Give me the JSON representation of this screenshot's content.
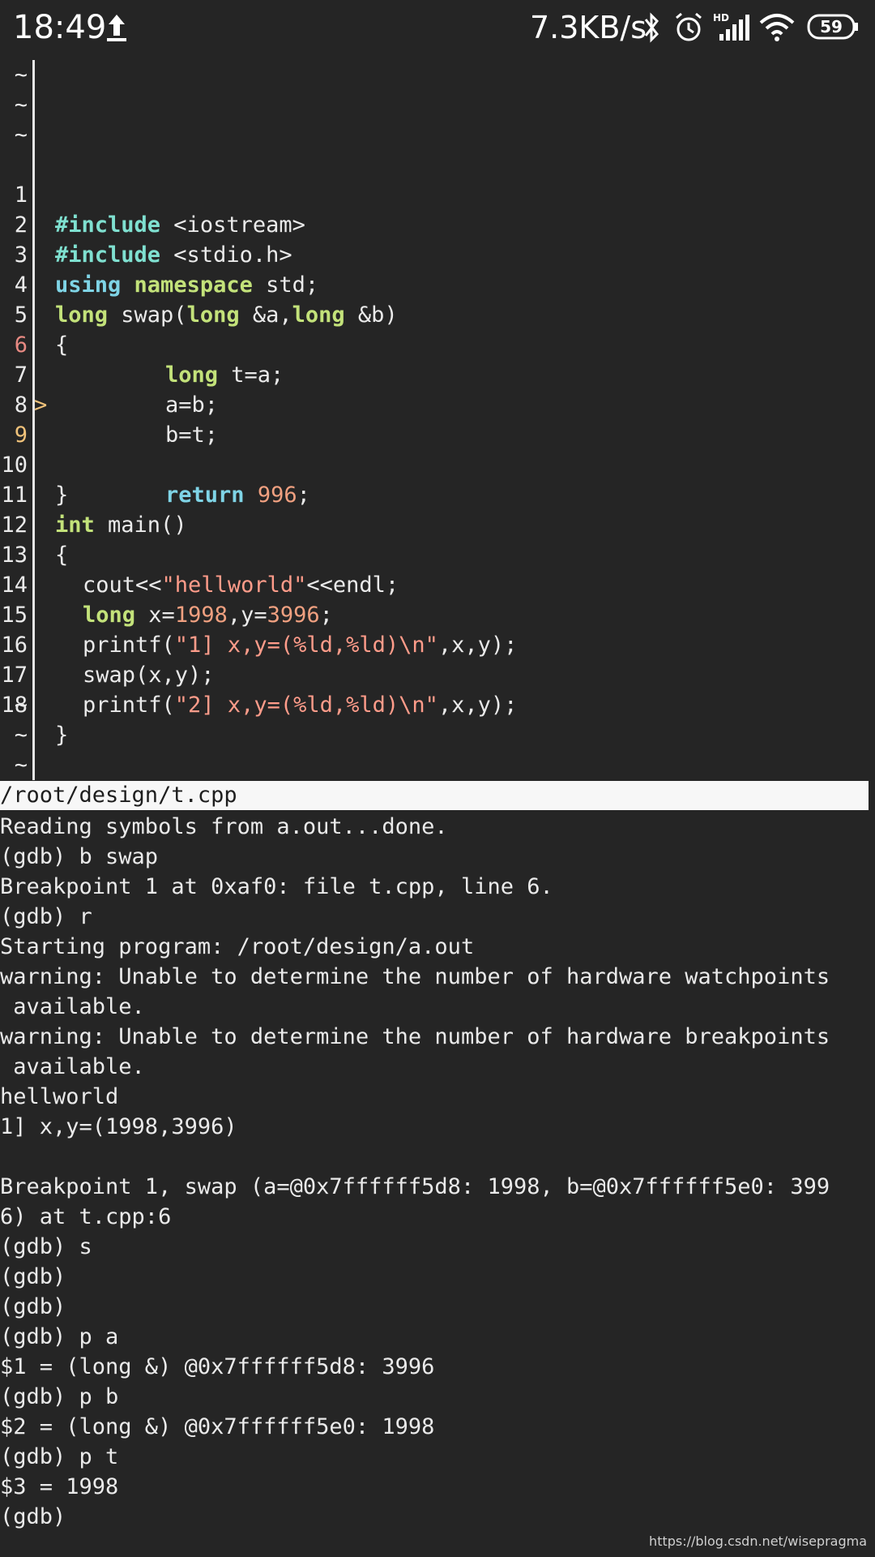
{
  "status_bar": {
    "time": "18:49",
    "net_speed": "7.3KB/s",
    "battery": "59",
    "icons": [
      "upload-icon",
      "bluetooth-icon",
      "alarm-icon",
      "hd-signal-icon",
      "wifi-icon",
      "battery-icon"
    ]
  },
  "editor": {
    "tilde": "~",
    "line_numbers": [
      "1",
      "2",
      "3",
      "4",
      "5",
      "6",
      "7",
      "8",
      "9",
      "10",
      "11",
      "12",
      "13",
      "14",
      "15",
      "16",
      "17",
      "18"
    ],
    "breakpoint_marker": ">",
    "code": {
      "l1a": "#include",
      "l1b": " <iostream>",
      "l2a": "#include",
      "l2b": " <stdio.h>",
      "l3a": "using",
      "l3b": " ",
      "l3c": "namespace",
      "l3d": " std;",
      "l4a": "long",
      "l4b": " swap(",
      "l4c": "long",
      "l4d": " &a,",
      "l4e": "long",
      "l4f": " &b)",
      "l5": "{",
      "l6a": "long",
      "l6b": " t=a;",
      "l7": "a=b;",
      "l8": "b=t;",
      "l9a": "return",
      "l9b": " ",
      "l9c": "996",
      "l9d": ";",
      "l10": "}",
      "l11a": "int",
      "l11b": " main()",
      "l12": "{",
      "l13a": "cout<<",
      "l13b": "\"hellworld\"",
      "l13c": "<<endl;",
      "l14a": "long",
      "l14b": " x=",
      "l14c": "1998",
      "l14d": ",y=",
      "l14e": "3996",
      "l14f": ";",
      "l15a": "printf(",
      "l15b": "\"1] x,y=(%ld,%ld)\\n\"",
      "l15c": ",x,y);",
      "l16": "swap(x,y);",
      "l17a": "printf(",
      "l17b": "\"2] x,y=(%ld,%ld)\\n\"",
      "l17c": ",x,y);",
      "l18": "}"
    }
  },
  "file_path": "/root/design/t.cpp",
  "gdb_output": [
    "Reading symbols from a.out...done.",
    "(gdb) b swap",
    "Breakpoint 1 at 0xaf0: file t.cpp, line 6.",
    "(gdb) r",
    "Starting program: /root/design/a.out",
    "warning: Unable to determine the number of hardware watchpoints",
    " available.",
    "warning: Unable to determine the number of hardware breakpoints",
    " available.",
    "hellworld",
    "1] x,y=(1998,3996)",
    "",
    "Breakpoint 1, swap (a=@0x7ffffff5d8: 1998, b=@0x7ffffff5e0: 399",
    "6) at t.cpp:6",
    "(gdb) s",
    "(gdb)",
    "(gdb)",
    "(gdb) p a",
    "$1 = (long &) @0x7ffffff5d8: 3996",
    "(gdb) p b",
    "$2 = (long &) @0x7ffffff5e0: 1998",
    "(gdb) p t",
    "$3 = 1998",
    "(gdb)"
  ],
  "watermark": "https://blog.csdn.net/wisepragma"
}
